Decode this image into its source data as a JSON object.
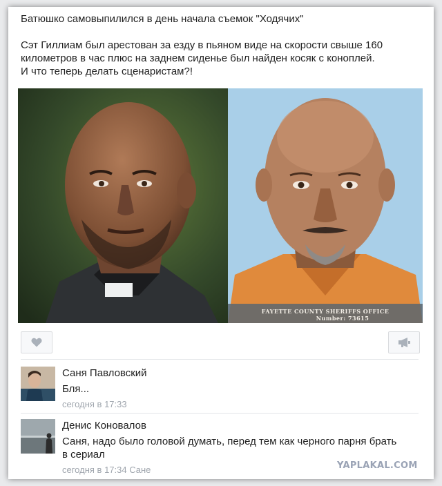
{
  "post": {
    "title": "Батюшко самовыпилился в день начала съемок \"Ходячих\"",
    "body_line1": "Сэт Гиллиам был арестован за езду в пьяном виде на скорости свыше 160",
    "body_line2": "километров в час плюс на заднем сиденье был найден косяк с коноплей.",
    "body_line3": "И что теперь делать сценаристам?!",
    "mugshot_caption": "FAYETTE COUNTY SHERIFFS OFFICE",
    "mugshot_number": "Number: 73615"
  },
  "actions": {
    "like_icon": "heart-icon",
    "share_icon": "megaphone-icon"
  },
  "comments": [
    {
      "author": "Саня Павловский",
      "text": "Бля...",
      "time": "сегодня в 17:33"
    },
    {
      "author": "Денис Коновалов",
      "text_line1": "Саня, надо было головой думать, перед тем как черного парня брать",
      "text_line2": "в сериал",
      "time": "сегодня в 17:34 Сане"
    }
  ],
  "watermark": "YAPLAKAL.COM",
  "colors": {
    "accent_gray": "#9fa5ad",
    "mugshot_background": "#a9cfe8",
    "mugshot_shirt": "#e08a3c"
  }
}
